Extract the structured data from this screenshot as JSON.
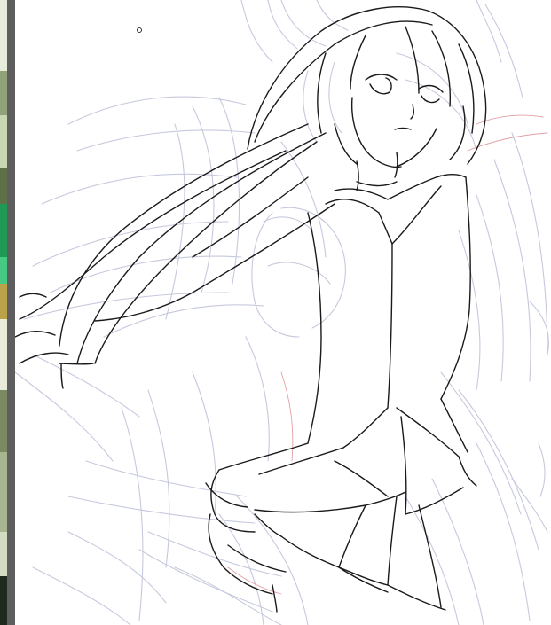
{
  "colors": {
    "canvas_background": "#ffffff",
    "gutter": "#5e5e5e",
    "sketch_line": "#1a1a1a",
    "rough_line": "#c6c9dd",
    "rough_line_alt": "#b9bcd6",
    "reference_red": "#e2a0a6",
    "left_strip_tones": [
      "#2c3a2a",
      "#5c6b46",
      "#9fb08a",
      "#d9e2c4",
      "#1a8a4e",
      "#3cc47a",
      "#b9a24a",
      "#e9ecd8",
      "#7c8a62",
      "#1f2a1e"
    ]
  },
  "tool": {
    "cursor_icon": "brush-circle-icon"
  }
}
